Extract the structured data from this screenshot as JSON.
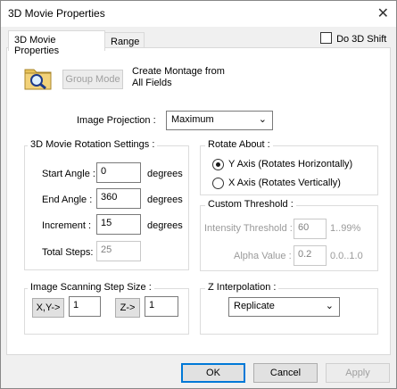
{
  "window": {
    "title": "3D Movie Properties",
    "close_glyph": "✕"
  },
  "tabs": [
    {
      "label": "3D Movie Properties"
    },
    {
      "label": "Range"
    }
  ],
  "do_3d_shift": {
    "label": "Do 3D Shift",
    "checked": false
  },
  "montage": {
    "group_mode_label": "Group Mode",
    "line1": "Create Montage from",
    "line2": "All Fields"
  },
  "image_projection": {
    "label": "Image Projection :",
    "value": "Maximum"
  },
  "rotation": {
    "title": "3D Movie Rotation Settings :",
    "start_label": "Start Angle :",
    "start_value": "0",
    "end_label": "End Angle :",
    "end_value": "360",
    "increment_label": "Increment :",
    "increment_value": "15",
    "unit": "degrees",
    "total_label": "Total Steps:",
    "total_value": "25"
  },
  "rotate_about": {
    "title": "Rotate About :",
    "y_axis": "Y Axis (Rotates Horizontally)",
    "x_axis": "X Axis (Rotates Vertically)",
    "selected": "y"
  },
  "custom_threshold": {
    "title": "Custom Threshold :",
    "intensity_label": "Intensity Threshold :",
    "intensity_value": "60",
    "intensity_range": "1..99%",
    "alpha_label": "Alpha Value :",
    "alpha_value": "0.2",
    "alpha_range": "0.0..1.0"
  },
  "scan_step": {
    "title": "Image Scanning Step Size :",
    "xy_button": "X,Y->",
    "xy_value": "1",
    "z_button": "Z->",
    "z_value": "1"
  },
  "z_interpolation": {
    "title": "Z Interpolation :",
    "value": "Replicate"
  },
  "buttons": {
    "ok": "OK",
    "cancel": "Cancel",
    "apply": "Apply"
  }
}
